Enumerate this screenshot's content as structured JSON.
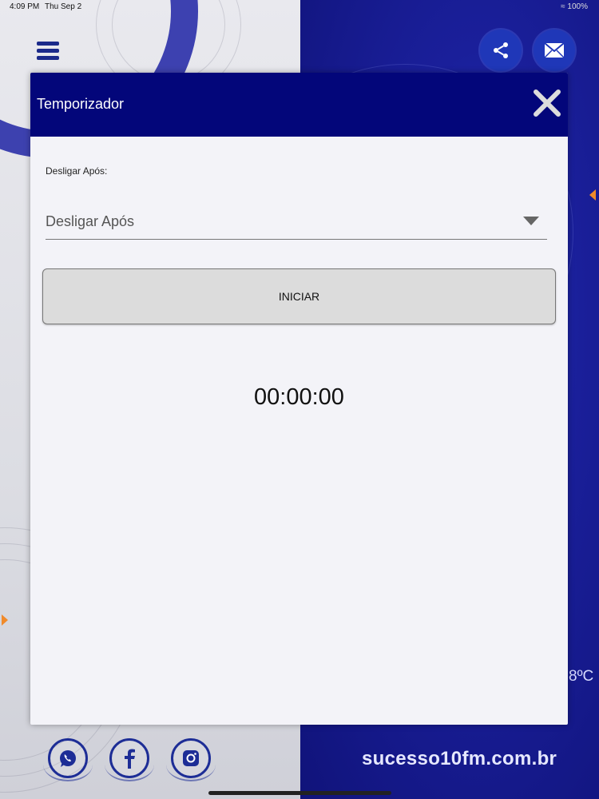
{
  "status_bar": {
    "time": "4:09 PM",
    "date": "Thu Sep 2",
    "battery": "100%"
  },
  "header_icons": {
    "menu": "hamburger-menu-icon",
    "share": "share-icon",
    "mail": "mail-icon"
  },
  "background": {
    "temperature": "8ºC",
    "website": "sucesso10fm.com.br"
  },
  "modal": {
    "title": "Temporizador",
    "close": "close-icon",
    "field_label": "Desligar Após:",
    "select_value": "Desligar Após",
    "start_label": "INICIAR",
    "timer_value": "00:00:00"
  },
  "social": {
    "items": [
      "whatsapp-icon",
      "facebook-icon",
      "instagram-icon"
    ]
  },
  "colors": {
    "header": "#03067a",
    "accent": "#1f37b8",
    "arrow": "#f08a2a"
  }
}
